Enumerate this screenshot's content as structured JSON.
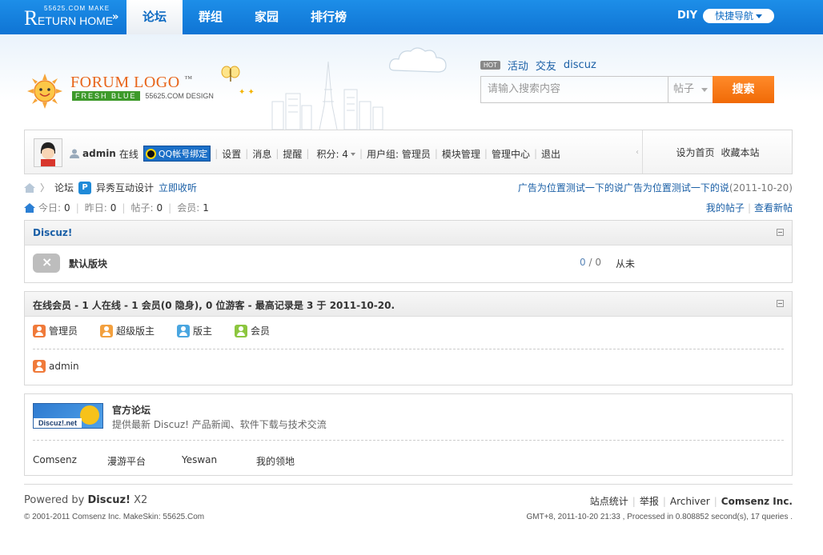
{
  "topbar": {
    "logo_small": "55625.COM MAKE",
    "logo_big_letter": "R",
    "logo_main": "ETURN HOME",
    "logo_arrows": "»",
    "nav": [
      "论坛",
      "群组",
      "家园",
      "排行榜"
    ],
    "active_nav": "论坛",
    "diy": "DIY",
    "quicknav": "快捷导航"
  },
  "header": {
    "logo_title": "FORUM LOGO",
    "logo_tm": "™",
    "logo_fresh": "FRESH BLUE",
    "logo_design": "55625.COM DESIGN",
    "hot_badge": "HOT",
    "hot_links": [
      "活动",
      "交友",
      "discuz"
    ],
    "search": {
      "placeholder": "请输入搜索内容",
      "type": "帖子",
      "button": "搜索"
    }
  },
  "userbar": {
    "username": "admin",
    "status": "在线",
    "qq_bind": "QQ帐号绑定",
    "links": [
      "设置",
      "消息",
      "提醒"
    ],
    "points_label": "积分: 4",
    "usergroup": "用户组: 管理员",
    "admin_links": [
      "模块管理",
      "管理中心",
      "退出"
    ],
    "right_links": [
      "设为首页",
      "收藏本站"
    ]
  },
  "breadcrumb": {
    "forum": "论坛",
    "site_name": "异秀互动设计",
    "collect": "立即收听",
    "ad_text": "广告为位置测试一下的说广告为位置测试一下的说",
    "ad_date": "(2011-10-20)"
  },
  "stats": {
    "today_label": "今日:",
    "today": "0",
    "yesterday_label": "昨日:",
    "yesterday": "0",
    "posts_label": "帖子:",
    "posts": "0",
    "members_label": "会员:",
    "members": "1",
    "my_posts": "我的帖子",
    "view_new": "查看新帖"
  },
  "forum_box": {
    "title": "Discuz!",
    "forum_name": "默认版块",
    "threads": "0",
    "slash": "/",
    "replies": "0",
    "last_post": "从未"
  },
  "online_box": {
    "title": "在线会员 - 1 人在线 - 1 会员(0 隐身), 0 位游客 - 最高记录是 3 于 2011-10-20.",
    "legend": [
      {
        "label": "管理员",
        "color": "#f07a3a"
      },
      {
        "label": "超级版主",
        "color": "#f3a03e"
      },
      {
        "label": "版主",
        "color": "#4aa6e0"
      },
      {
        "label": "会员",
        "color": "#8cc63f"
      }
    ],
    "online_user": "admin",
    "online_user_color": "#f07a3a"
  },
  "links_box": {
    "logo_text": "Discuz!.net",
    "official_name": "官方论坛",
    "official_desc": "提供最新 Discuz! 产品新闻、软件下载与技术交流",
    "friend_links": [
      "Comsenz",
      "漫游平台",
      "Yeswan",
      "我的领地"
    ]
  },
  "footer": {
    "powered_prefix": "Powered by",
    "powered_name": "Discuz!",
    "powered_ver": "X2",
    "copyright": "© 2001-2011 Comsenz Inc. MakeSkin:",
    "makeskin": "55625.Com",
    "links": [
      "站点统计",
      "举报",
      "Archiver"
    ],
    "company": "Comsenz Inc.",
    "gmt": "GMT+8, 2011-10-20 21:33 , Processed in 0.808852 second(s), 17 queries ."
  }
}
